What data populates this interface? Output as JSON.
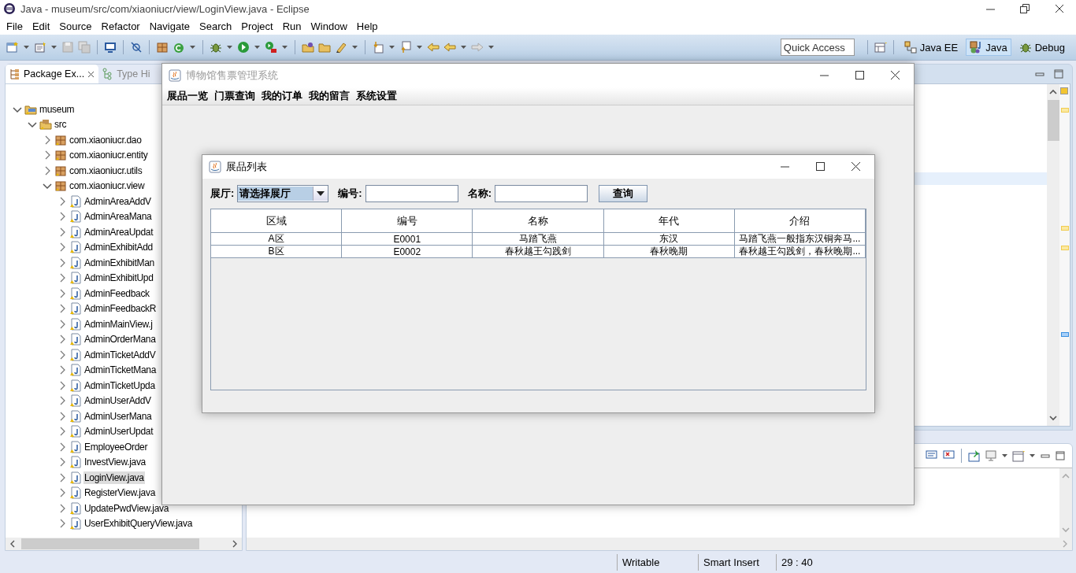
{
  "window": {
    "title": "Java - museum/src/com/xiaoniucr/view/LoginView.java - Eclipse"
  },
  "menu": [
    "File",
    "Edit",
    "Source",
    "Refactor",
    "Navigate",
    "Search",
    "Project",
    "Run",
    "Window",
    "Help"
  ],
  "quick_access": {
    "placeholder": "Quick Access"
  },
  "perspectives": [
    {
      "label": "Java EE",
      "kind": "javaee",
      "selected": false
    },
    {
      "label": "Java",
      "kind": "java",
      "selected": true
    },
    {
      "label": "Debug",
      "kind": "debug",
      "selected": false
    }
  ],
  "left_panel": {
    "tabs": [
      {
        "label": "Package Ex...",
        "kind": "package",
        "selected": true
      },
      {
        "label": "Type Hi",
        "kind": "hierarchy",
        "selected": false
      }
    ],
    "tree": [
      {
        "label": "museum",
        "kind": "project",
        "expanded": true,
        "selected": false,
        "children": [
          {
            "label": "src",
            "kind": "folder",
            "expanded": true,
            "selected": false,
            "children": [
              {
                "label": "com.xiaoniucr.dao",
                "kind": "package",
                "expanded": false,
                "selected": false
              },
              {
                "label": "com.xiaoniucr.entity",
                "kind": "package",
                "expanded": false,
                "selected": false
              },
              {
                "label": "com.xiaoniucr.utils",
                "kind": "package",
                "expanded": false,
                "selected": false
              },
              {
                "label": "com.xiaoniucr.view",
                "kind": "package",
                "expanded": true,
                "selected": false,
                "children": [
                  {
                    "label": "AdminAreaAddV",
                    "kind": "file",
                    "expanded": false,
                    "selected": false
                  },
                  {
                    "label": "AdminAreaMana",
                    "kind": "file",
                    "expanded": false,
                    "selected": false
                  },
                  {
                    "label": "AdminAreaUpdat",
                    "kind": "file",
                    "expanded": false,
                    "selected": false
                  },
                  {
                    "label": "AdminExhibitAdd",
                    "kind": "file",
                    "expanded": false,
                    "selected": false
                  },
                  {
                    "label": "AdminExhibitMan",
                    "kind": "file",
                    "expanded": false,
                    "selected": false
                  },
                  {
                    "label": "AdminExhibitUpd",
                    "kind": "file",
                    "expanded": false,
                    "selected": false
                  },
                  {
                    "label": "AdminFeedback",
                    "kind": "file",
                    "expanded": false,
                    "selected": false
                  },
                  {
                    "label": "AdminFeedbackR",
                    "kind": "file",
                    "expanded": false,
                    "selected": false
                  },
                  {
                    "label": "AdminMainView.j",
                    "kind": "file",
                    "expanded": false,
                    "selected": false
                  },
                  {
                    "label": "AdminOrderMana",
                    "kind": "file",
                    "expanded": false,
                    "selected": false
                  },
                  {
                    "label": "AdminTicketAddV",
                    "kind": "file",
                    "expanded": false,
                    "selected": false
                  },
                  {
                    "label": "AdminTicketMana",
                    "kind": "file",
                    "expanded": false,
                    "selected": false
                  },
                  {
                    "label": "AdminTicketUpda",
                    "kind": "file",
                    "expanded": false,
                    "selected": false
                  },
                  {
                    "label": "AdminUserAddV",
                    "kind": "file",
                    "expanded": false,
                    "selected": false
                  },
                  {
                    "label": "AdminUserMana",
                    "kind": "file",
                    "expanded": false,
                    "selected": false
                  },
                  {
                    "label": "AdminUserUpdat",
                    "kind": "file",
                    "expanded": false,
                    "selected": false
                  },
                  {
                    "label": "EmployeeOrder",
                    "kind": "file",
                    "expanded": false,
                    "selected": false
                  },
                  {
                    "label": "InvestView.java",
                    "kind": "file",
                    "expanded": false,
                    "selected": false
                  },
                  {
                    "label": "LoginView.java",
                    "kind": "file",
                    "expanded": false,
                    "selected": true
                  },
                  {
                    "label": "RegisterView.java",
                    "kind": "file",
                    "expanded": false,
                    "selected": false
                  },
                  {
                    "label": "UpdatePwdView.java",
                    "kind": "file",
                    "expanded": false,
                    "selected": false
                  },
                  {
                    "label": "UserExhibitQueryView.java",
                    "kind": "file",
                    "expanded": false,
                    "selected": false
                  }
                ]
              }
            ]
          }
        ]
      }
    ]
  },
  "status_bar": [
    "Writable",
    "Smart Insert",
    "29 : 40"
  ],
  "app_window": {
    "title": "博物馆售票管理系统",
    "active": false,
    "menu": [
      "展品一览",
      "门票查询",
      "我的订单",
      "我的留言",
      "系统设置"
    ]
  },
  "dialog": {
    "title": "展品列表",
    "active": true,
    "hall": {
      "label": "展厅:",
      "value": "请选择展厅",
      "focused": true
    },
    "fields": [
      {
        "label": "编号:"
      },
      {
        "label": "名称:"
      }
    ],
    "button": "查询",
    "table": {
      "columns": [
        "区域",
        "编号",
        "名称",
        "年代",
        "介绍"
      ],
      "rows": [
        [
          "A区",
          "E0001",
          "马踏飞燕",
          "东汉",
          "马踏飞燕一般指东汉铜奔马..."
        ],
        [
          "B区",
          "E0002",
          "春秋越王勾践剑",
          "春秋晚期",
          "春秋越王勾践剑，春秋晚期..."
        ]
      ]
    }
  }
}
